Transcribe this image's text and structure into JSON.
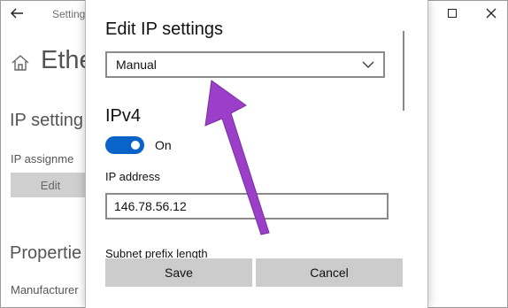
{
  "window": {
    "title": "Settings",
    "back_icon": "arrow-left-icon",
    "controls": {
      "minimize_icon": "minimize-icon",
      "maximize_icon": "maximize-icon",
      "close_icon": "close-icon"
    }
  },
  "background": {
    "heading": "Ethe",
    "ip_section": "IP setting",
    "ip_assignment_label": "IP assignme",
    "edit_button": "Edit",
    "properties_section": "Propertie",
    "manufacturer_label": "Manufacturer"
  },
  "dialog": {
    "title": "Edit IP settings",
    "mode_select": {
      "value": "Manual"
    },
    "ipv4_heading": "IPv4",
    "toggle": {
      "state_label": "On",
      "color": "#0a63c9"
    },
    "ip_address": {
      "label": "IP address",
      "value": "146.78.56.12"
    },
    "subnet_label": "Subnet prefix length",
    "buttons": {
      "save": "Save",
      "cancel": "Cancel"
    }
  },
  "annotation": {
    "arrow_color": "#9b3fc8",
    "arrow_icon": "annotation-arrow-icon"
  }
}
